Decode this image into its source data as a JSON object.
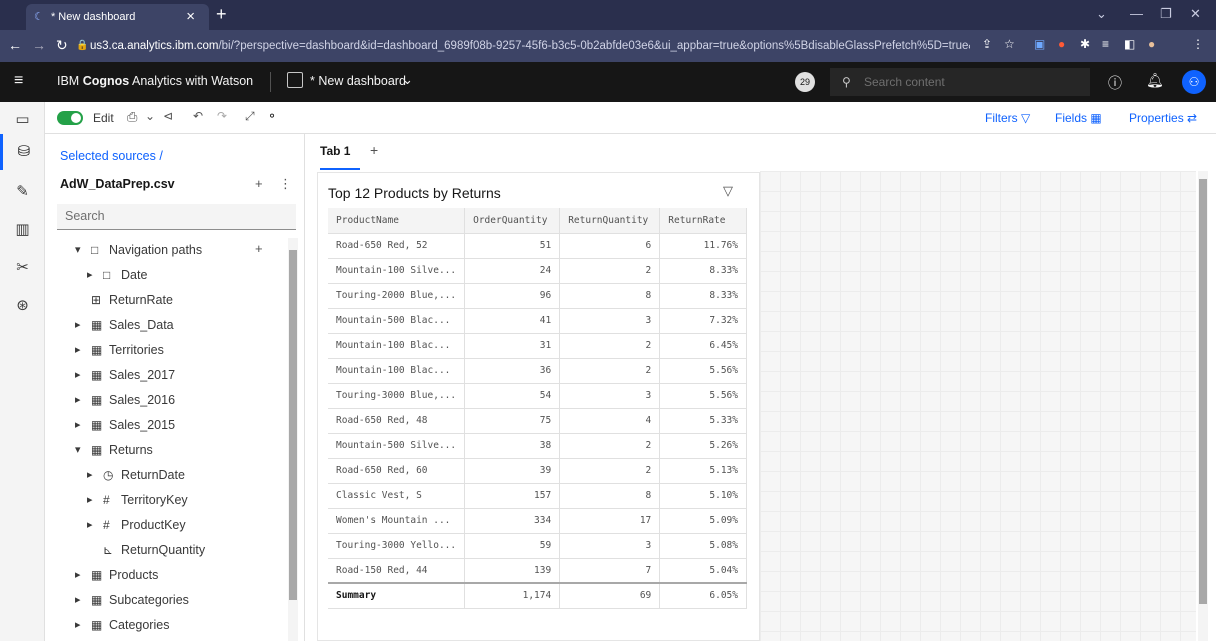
{
  "browser": {
    "tab_title": "* New dashboard",
    "url_host": "us3.ca.analytics.ibm.com",
    "url_path": "/bi/?perspective=dashboard&id=dashboard_6989f08b-9257-45f6-b3c5-0b2abfde03e6&ui_appbar=true&options%5BdisableGlassPrefetch%5D=true&..."
  },
  "appbar": {
    "brand": "IBM Cognos Analytics with Watson",
    "brand_bold": "Cognos",
    "dashboard_title": "* New dashboard",
    "notification_count": "29",
    "search_placeholder": "Search content"
  },
  "toolbar": {
    "edit_label": "Edit",
    "filters_label": "Filters",
    "fields_label": "Fields",
    "properties_label": "Properties"
  },
  "tabs": {
    "active": "Tab 1",
    "add": "+"
  },
  "sources": {
    "breadcrumb": "Selected sources /",
    "file": "AdW_DataPrep.csv",
    "search_placeholder": "Search",
    "tree": [
      {
        "label": "Navigation paths",
        "icon": "folder-icon",
        "caret": "down",
        "indent": 0
      },
      {
        "label": "Date",
        "icon": "folder-icon",
        "caret": "right",
        "indent": 1
      },
      {
        "label": "ReturnRate",
        "icon": "calc-icon",
        "caret": "",
        "indent": 0
      },
      {
        "label": "Sales_Data",
        "icon": "table-icon",
        "caret": "right",
        "indent": 0
      },
      {
        "label": "Territories",
        "icon": "table-icon",
        "caret": "right",
        "indent": 0
      },
      {
        "label": "Sales_2017",
        "icon": "table-icon",
        "caret": "right",
        "indent": 0
      },
      {
        "label": "Sales_2016",
        "icon": "table-icon",
        "caret": "right",
        "indent": 0
      },
      {
        "label": "Sales_2015",
        "icon": "table-icon",
        "caret": "right",
        "indent": 0
      },
      {
        "label": "Returns",
        "icon": "table-icon",
        "caret": "down",
        "indent": 0
      },
      {
        "label": "ReturnDate",
        "icon": "clock-icon",
        "caret": "right",
        "indent": 1
      },
      {
        "label": "TerritoryKey",
        "icon": "hash-icon",
        "caret": "right",
        "indent": 1
      },
      {
        "label": "ProductKey",
        "icon": "hash-icon",
        "caret": "right",
        "indent": 1
      },
      {
        "label": "ReturnQuantity",
        "icon": "measure-icon",
        "caret": "",
        "indent": 1
      },
      {
        "label": "Products",
        "icon": "table-icon",
        "caret": "right",
        "indent": 0
      },
      {
        "label": "Subcategories",
        "icon": "table-icon",
        "caret": "right",
        "indent": 0
      },
      {
        "label": "Categories",
        "icon": "table-icon",
        "caret": "right",
        "indent": 0
      }
    ]
  },
  "widget": {
    "title": "Top 12 Products by Returns",
    "columns": [
      "ProductName",
      "OrderQuantity",
      "ReturnQuantity",
      "ReturnRate"
    ],
    "rows": [
      [
        "Road-650 Red, 52",
        "51",
        "6",
        "11.76%"
      ],
      [
        "Mountain-100 Silve...",
        "24",
        "2",
        "8.33%"
      ],
      [
        "Touring-2000 Blue,...",
        "96",
        "8",
        "8.33%"
      ],
      [
        "Mountain-500 Blac...",
        "41",
        "3",
        "7.32%"
      ],
      [
        "Mountain-100 Blac...",
        "31",
        "2",
        "6.45%"
      ],
      [
        "Mountain-100 Blac...",
        "36",
        "2",
        "5.56%"
      ],
      [
        "Touring-3000 Blue,...",
        "54",
        "3",
        "5.56%"
      ],
      [
        "Road-650 Red, 48",
        "75",
        "4",
        "5.33%"
      ],
      [
        "Mountain-500 Silve...",
        "38",
        "2",
        "5.26%"
      ],
      [
        "Road-650 Red, 60",
        "39",
        "2",
        "5.13%"
      ],
      [
        "Classic Vest, S",
        "157",
        "8",
        "5.10%"
      ],
      [
        "Women's Mountain ...",
        "334",
        "17",
        "5.09%"
      ],
      [
        "Touring-3000 Yello...",
        "59",
        "3",
        "5.08%"
      ],
      [
        "Road-150 Red, 44",
        "139",
        "7",
        "5.04%"
      ]
    ],
    "summary": [
      "Summary",
      "1,174",
      "69",
      "6.05%"
    ]
  },
  "colors": {
    "accent": "#0f62fe",
    "toggle_on": "#24a148",
    "appbar_bg": "#161616",
    "browser_bg": "#2a2f4d"
  }
}
